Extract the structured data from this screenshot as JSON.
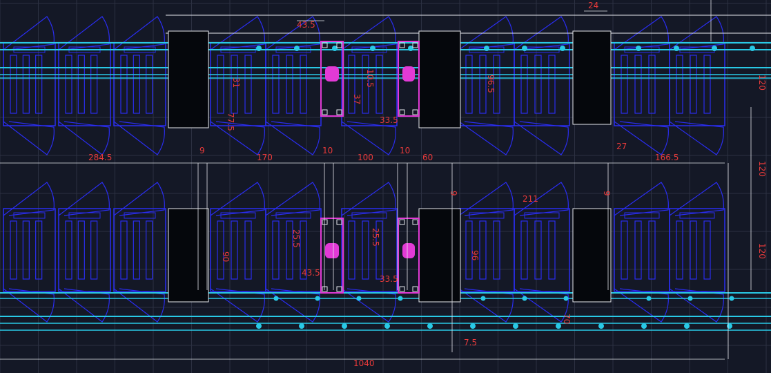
{
  "colors": {
    "background": "#141826",
    "grid": "#2c3142",
    "outline": "#2a2df0",
    "rail": "#29c9e6",
    "device": "#e23ad6",
    "dimension": "#e83a3a",
    "white": "#e6e8ee",
    "black_block": "#05070c"
  },
  "dimensions": {
    "d_43_5_top": "43.5",
    "d_24": "24",
    "d_10_5": "10.5",
    "d_37": "37",
    "d_31": "31",
    "d_77_5": "77.5",
    "d_33_5_top": "33.5",
    "d_96_5": "96.5",
    "d_27": "27",
    "d_120_a": "120",
    "d_284_5": "284.5",
    "d_9_a": "9",
    "d_170": "170",
    "d_10_a": "10",
    "d_100": "100",
    "d_10_b": "10",
    "d_60": "60",
    "d_166_5": "166.5",
    "d_120_b": "120",
    "d_211": "211",
    "d_9_b": "9",
    "d_9_c": "9",
    "d_25_5_a": "25.5",
    "d_25_5_b": "25.5",
    "d_90": "90",
    "d_43_5_bot": "43.5",
    "d_33_5_bot": "33.5",
    "d_96_b": "96",
    "d_120_c": "120",
    "d_70": "70",
    "d_7_5": "7.5",
    "d_1040": "1040"
  }
}
